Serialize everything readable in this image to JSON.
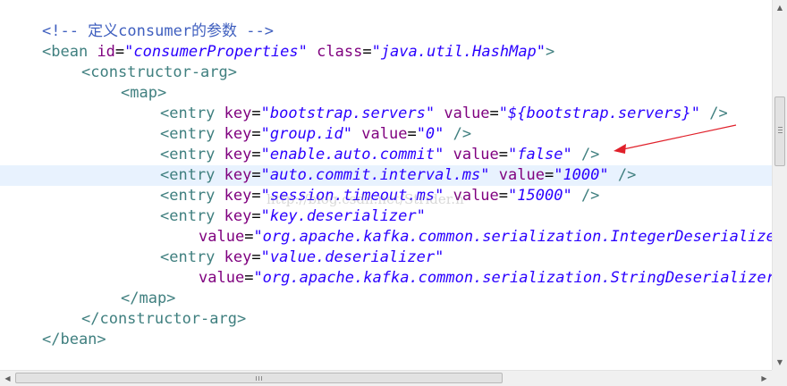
{
  "editor": {
    "comment": "<!-- 定义consumer的参数 -->",
    "bean": {
      "open_start": "<bean",
      "id_attr": "id",
      "id_value": "\"consumerProperties\"",
      "class_attr": "class",
      "class_value": "\"java.util.HashMap\"",
      "open_end": ">",
      "close": "</bean>"
    },
    "constructor_arg": {
      "open": "<constructor-arg>",
      "close": "</constructor-arg>"
    },
    "map": {
      "open": "<map>",
      "close": "</map>"
    },
    "entries": [
      {
        "tag": "<entry",
        "key_attr": "key",
        "key": "\"bootstrap.servers\"",
        "value_attr": "value",
        "value": "\"${bootstrap.servers}\"",
        "end": "/>"
      },
      {
        "tag": "<entry",
        "key_attr": "key",
        "key": "\"group.id\"",
        "value_attr": "value",
        "value": "\"0\"",
        "end": "/>"
      },
      {
        "tag": "<entry",
        "key_attr": "key",
        "key": "\"enable.auto.commit\"",
        "value_attr": "value",
        "value": "\"false\"",
        "end": "/>"
      },
      {
        "tag": "<entry",
        "key_attr": "key",
        "key": "\"auto.commit.interval.ms\"",
        "value_attr": "value",
        "value": "\"1000\"",
        "end": "/>"
      },
      {
        "tag": "<entry",
        "key_attr": "key",
        "key": "\"session.timeout.ms\"",
        "value_attr": "value",
        "value": "\"15000\"",
        "end": "/>"
      },
      {
        "tag": "<entry",
        "key_attr": "key",
        "key": "\"key.deserializer\"",
        "value_attr": "value",
        "value": "\"org.apache.kafka.common.serialization.IntegerDeserializer\""
      },
      {
        "tag": "<entry",
        "key_attr": "key",
        "key": "\"value.deserializer\"",
        "value_attr": "value",
        "value": "\"org.apache.kafka.common.serialization.StringDeserializer\""
      }
    ],
    "watermark": "http://blog.csdn.net/Strider.n",
    "highlighted_line": 7
  },
  "scrollbar_icons": {
    "up": "arrow-up-icon",
    "down": "arrow-down-icon",
    "left": "arrow-left-icon",
    "right": "arrow-right-icon"
  },
  "colors": {
    "tag": "#3f7f7f",
    "attribute": "#7f007f",
    "value": "#2a00ff",
    "comment": "#3f5fbf",
    "highlight": "#e8f2fe",
    "annotation_arrow": "#e0202a"
  }
}
